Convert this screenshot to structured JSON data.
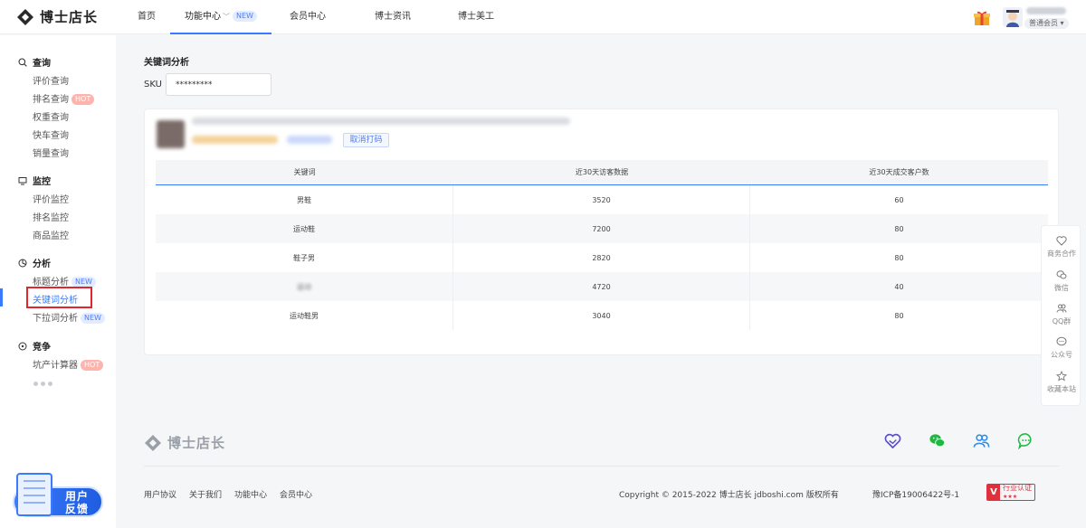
{
  "brand": {
    "name": "博士店长"
  },
  "nav": {
    "items": [
      {
        "label": "首页"
      },
      {
        "label": "功能中心",
        "badge": "NEW"
      },
      {
        "label": "会员中心"
      },
      {
        "label": "博士资讯"
      },
      {
        "label": "博士美工"
      }
    ]
  },
  "user": {
    "level": "普通会员"
  },
  "sidebar": {
    "groups": [
      {
        "title": "查询",
        "icon": "search-icon",
        "items": [
          {
            "label": "评价查询"
          },
          {
            "label": "排名查询",
            "badge": "HOT"
          },
          {
            "label": "权重查询"
          },
          {
            "label": "快车查询"
          },
          {
            "label": "销量查询"
          }
        ]
      },
      {
        "title": "监控",
        "icon": "monitor-icon",
        "items": [
          {
            "label": "评价监控"
          },
          {
            "label": "排名监控"
          },
          {
            "label": "商品监控"
          }
        ]
      },
      {
        "title": "分析",
        "icon": "analysis-icon",
        "items": [
          {
            "label": "标题分析",
            "badge": "NEW"
          },
          {
            "label": "关键词分析"
          },
          {
            "label": "下拉词分析",
            "badge": "NEW"
          }
        ]
      },
      {
        "title": "竞争",
        "icon": "compete-icon",
        "items": [
          {
            "label": "坑产计算器",
            "badge": "HOT"
          }
        ]
      }
    ],
    "feedback": {
      "line1": "用户",
      "line2": "反馈"
    }
  },
  "main": {
    "title": "关键词分析",
    "sku_label": "SKU",
    "sku_value": "*********",
    "cancel_button": "取消打码",
    "table": {
      "headers": [
        "关键词",
        "近30天访客数据",
        "近30天成交客户数"
      ],
      "rows": [
        [
          "男鞋",
          "3520",
          "60"
        ],
        [
          "运动鞋",
          "7200",
          "80"
        ],
        [
          "鞋子男",
          "2820",
          "80"
        ],
        [
          "运动",
          "4720",
          "40"
        ],
        [
          "运动鞋男",
          "3040",
          "80"
        ]
      ]
    }
  },
  "float_panel": {
    "items": [
      {
        "label": "商务合作",
        "icon": "handshake-icon"
      },
      {
        "label": "微信",
        "icon": "wechat-icon"
      },
      {
        "label": "QQ群",
        "icon": "group-icon"
      },
      {
        "label": "公众号",
        "icon": "chat-icon"
      },
      {
        "label": "收藏本站",
        "icon": "star-icon"
      }
    ]
  },
  "footer": {
    "links": [
      "用户协议",
      "关于我们",
      "功能中心",
      "会员中心"
    ],
    "copyright": "Copyright © 2015-2022 博士店长 jdboshi.com 版权所有",
    "icp": "豫ICP备19006422号-1",
    "cert": "行业认证"
  },
  "colors": {
    "accent": "#3a7bfd",
    "hot": "#ffb3ad",
    "highlight": "#e3262e"
  }
}
